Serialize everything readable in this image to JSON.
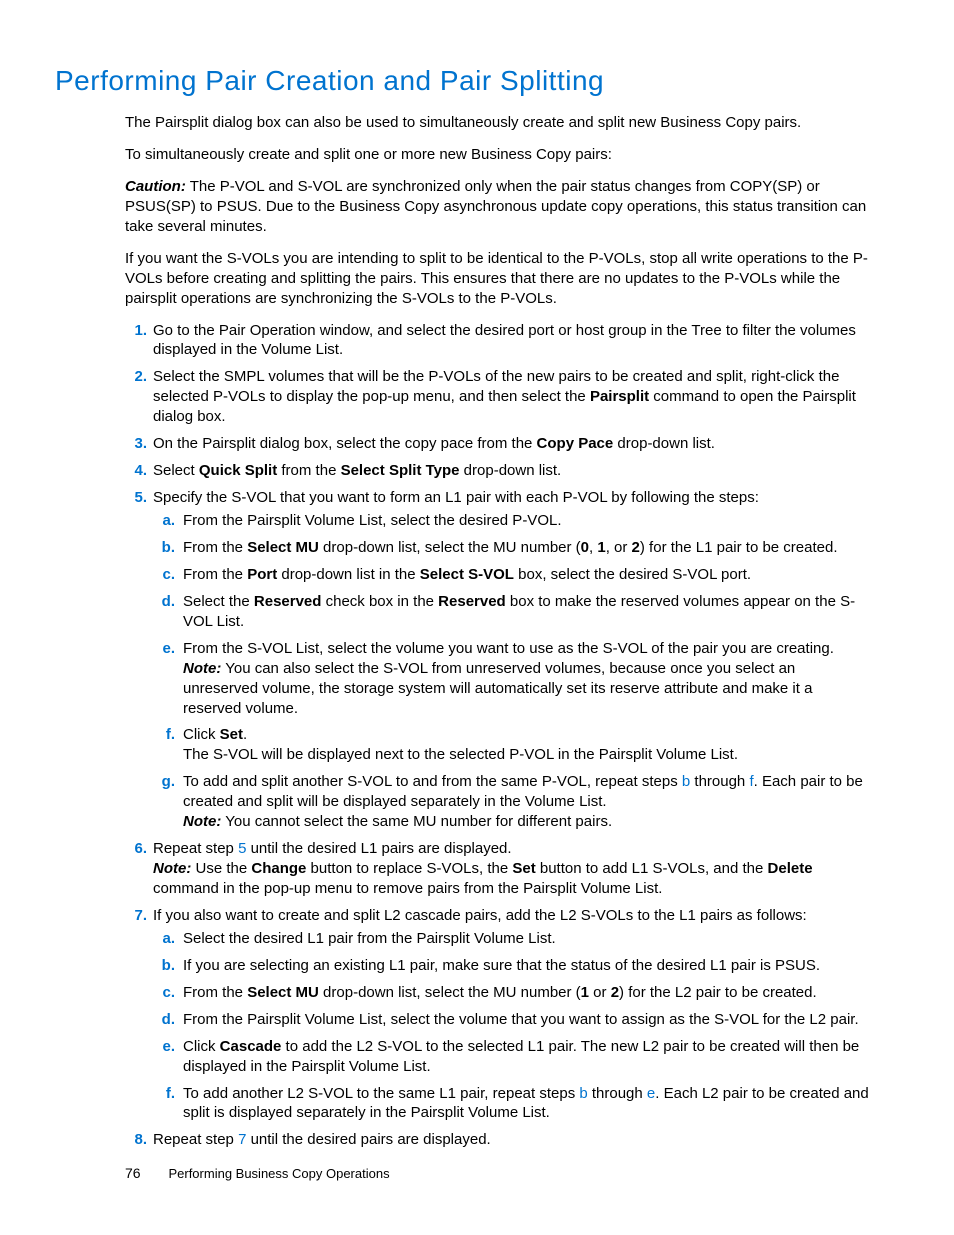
{
  "title": "Performing Pair Creation and Pair Splitting",
  "p1": "The Pairsplit dialog box can also be used to simultaneously create and split new Business Copy pairs.",
  "p2": "To simultaneously create and split one or more new Business Copy pairs:",
  "caution_label": "Caution:",
  "caution_body": "The P-VOL and S-VOL are synchronized only when the pair status changes from COPY(SP) or PSUS(SP) to PSUS. Due to the Business Copy asynchronous update copy operations, this status transition can take several minutes.",
  "p3": "If you want the S-VOLs you are intending to split to be identical to the P-VOLs, stop all write operations to the P-VOLs before creating and splitting the pairs. This ensures that there are no updates to the P-VOLs while the pairsplit operations are synchronizing the S-VOLs to the P-VOLs.",
  "s1": "Go to the Pair Operation window, and select the desired port or host group in the Tree to filter the volumes displayed in the Volume List.",
  "s2a": "Select the SMPL volumes that will be the P-VOLs of the new pairs to be created and split, right-click the selected P-VOLs to display the pop-up menu, and then select the ",
  "s2b_bold": "Pairsplit",
  "s2c": " command to open the Pairsplit dialog box.",
  "s3a": "On the Pairsplit dialog box, select the copy pace from the ",
  "s3b": "Copy Pace",
  "s3c": " drop-down list.",
  "s4a": "Select ",
  "s4b": "Quick Split",
  "s4c": " from the ",
  "s4d": "Select Split Type",
  "s4e": " drop-down list.",
  "s5": "Specify the S-VOL that you want to form an L1 pair with each P-VOL by following the steps:",
  "s5a": "From the Pairsplit Volume List, select the desired P-VOL.",
  "s5b_1": "From the ",
  "s5b_2": "Select MU",
  "s5b_3": " drop-down list, select the MU number (",
  "s5b_4": "0",
  "s5b_5": ", ",
  "s5b_6": "1",
  "s5b_7": ", or ",
  "s5b_8": "2",
  "s5b_9": ") for the L1 pair to be created.",
  "s5c_1": "From the ",
  "s5c_2": "Port",
  "s5c_3": " drop-down list in the ",
  "s5c_4": "Select S-VOL",
  "s5c_5": " box, select the desired S-VOL port.",
  "s5d_1": "Select the ",
  "s5d_2": "Reserved",
  "s5d_3": " check box in the ",
  "s5d_4": "Reserved",
  "s5d_5": " box to make the reserved volumes appear on the S-VOL List.",
  "s5e_1": "From the S-VOL List, select the volume you want to use as the S-VOL of the pair you are creating.",
  "s5e_note_label": "Note:",
  "s5e_note": "You can also select the S-VOL from unreserved volumes, because once you select an unreserved volume, the storage system will automatically set its reserve attribute and make it a reserved volume.",
  "s5f_1": "Click ",
  "s5f_2": "Set",
  "s5f_3": ".",
  "s5f_4": "The S-VOL will be displayed next to the selected P-VOL in the Pairsplit Volume List.",
  "s5g_1": "To add and split another S-VOL to and from the same P-VOL, repeat steps ",
  "s5g_b": "b",
  "s5g_2": " through ",
  "s5g_f": "f",
  "s5g_3": ".  Each pair to be created and split will be displayed separately in the Volume List.",
  "s5g_note_label": "Note:",
  "s5g_note": "You cannot select the same MU number for different pairs.",
  "s6_1": "Repeat step ",
  "s6_5": "5",
  "s6_2": " until the desired L1 pairs are displayed.",
  "s6_note_label": "Note:",
  "s6_note_1": "Use the ",
  "s6_note_2": "Change",
  "s6_note_3": " button to replace S-VOLs, the ",
  "s6_note_4": "Set",
  "s6_note_5": " button to add L1 S-VOLs, and the ",
  "s6_note_6": "Delete",
  "s6_note_7": " command in the pop-up menu to remove pairs from the Pairsplit Volume List.",
  "s7": "If you also want to create and split L2 cascade pairs, add the L2 S-VOLs to the L1 pairs as follows:",
  "s7a": "Select the desired L1 pair from the Pairsplit Volume List.",
  "s7b": "If you are selecting an existing L1 pair, make sure that the status of the desired L1 pair is PSUS.",
  "s7c_1": "From the ",
  "s7c_2": "Select MU",
  "s7c_3": " drop-down list, select the MU number (",
  "s7c_4": "1",
  "s7c_5": " or ",
  "s7c_6": "2",
  "s7c_7": ") for the L2 pair to be created.",
  "s7d": "From the Pairsplit Volume List, select the volume that you want to assign as the S-VOL for the L2 pair.",
  "s7e_1": "Click ",
  "s7e_2": "Cascade",
  "s7e_3": " to add the L2 S-VOL to the selected L1 pair. The new L2 pair to be created will then be displayed in the Pairsplit Volume List.",
  "s7f_1": "To add another L2 S-VOL to the same L1 pair, repeat steps ",
  "s7f_b": "b",
  "s7f_2": " through ",
  "s7f_e": "e",
  "s7f_3": ".  Each L2 pair to be created and split is displayed separately in the Pairsplit Volume List.",
  "s8_1": "Repeat step ",
  "s8_7": "7",
  "s8_2": " until the desired pairs are displayed.",
  "footer_page": "76",
  "footer_chapter": "Performing Business Copy Operations"
}
